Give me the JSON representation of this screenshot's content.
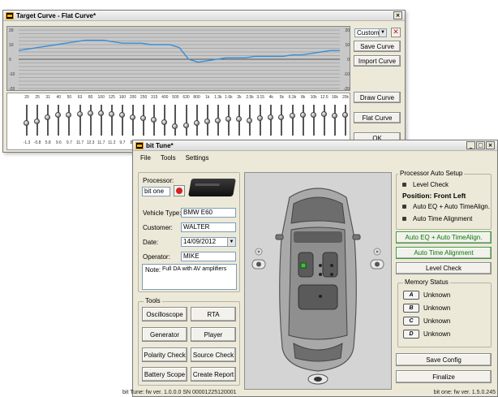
{
  "target_window": {
    "title": "Target Curve - Flat Curve*",
    "close": "×",
    "preset_select": "Custom",
    "save_curve": "Save Curve",
    "import_curve": "Import Curve",
    "draw_curve": "Draw Curve",
    "flat_curve": "Flat Curve",
    "ok": "OK",
    "graph": {
      "left_ticks": [
        "20",
        "10",
        "0",
        "-10",
        "-20"
      ],
      "right_ticks": [
        "20",
        "10",
        "0",
        "-10",
        "-20"
      ],
      "curve_values": [
        6,
        7,
        8,
        9,
        10,
        11,
        12,
        13,
        13,
        13,
        12,
        11,
        11,
        11,
        10,
        10,
        10,
        8,
        0,
        -2,
        -1,
        0,
        1,
        1,
        1,
        2,
        2,
        2,
        2,
        3,
        3,
        4,
        5,
        6,
        6
      ]
    },
    "freq_labels": [
      "20",
      "25",
      "31",
      "40",
      "50",
      "63",
      "80",
      "100",
      "125",
      "160",
      "200",
      "250",
      "315",
      "400",
      "500",
      "630",
      "800",
      "1k",
      "1.3k",
      "1.6k",
      "2k",
      "2.5k",
      "3.15",
      "4k",
      "5k",
      "6.3k",
      "8k",
      "10k",
      "12.5",
      "16k",
      "20k"
    ],
    "gain_labels": [
      "-1.3",
      "-0.8",
      "5.8",
      "9.6",
      "9.7",
      "11.7",
      "12.3",
      "11.7",
      "11.2",
      "9.7",
      "8.0"
    ],
    "slider_levels": [
      0.62,
      0.55,
      0.4,
      0.3,
      0.3,
      0.25,
      0.22,
      0.22,
      0.25,
      0.3,
      0.38,
      0.42,
      0.48,
      0.58,
      0.75,
      0.72,
      0.6,
      0.55,
      0.5,
      0.45,
      0.45,
      0.5,
      0.42,
      0.4,
      0.38,
      0.32,
      0.28,
      0.3,
      0.25,
      0.32,
      0.3
    ]
  },
  "main_window": {
    "title": "bit Tune*",
    "controls": [
      "_",
      "□",
      "×"
    ],
    "menu": [
      "File",
      "Tools",
      "Settings"
    ],
    "processor_label": "Processor:",
    "processor_value": "bit one",
    "vehicle_label": "Vehicle Type:",
    "vehicle_value": "BMW E60",
    "customer_label": "Customer:",
    "customer_value": "WALTER",
    "date_label": "Date:",
    "date_value": "14/09/2012",
    "operator_label": "Operator:",
    "operator_value": "MIKE",
    "note_label": "Note:",
    "note_value": "Full DA with AV amplifiers",
    "tools_title": "Tools",
    "tools": [
      "Oscilloscope",
      "RTA",
      "Generator",
      "Player",
      "Polarity Check",
      "Source Check",
      "Battery Scope",
      "Create Report"
    ],
    "auto_setup_title": "Processor Auto Setup",
    "level_check_item": "Level Check",
    "position_label": "Position: Front Left",
    "auto_eq_item": "Auto EQ + Auto TimeAlign.",
    "auto_time_item": "Auto Time Alignment",
    "btn_auto_eq": "Auto EQ + Auto TimeAlign.",
    "btn_auto_time": "Auto Time Alignment",
    "btn_level_check": "Level Check",
    "memory_title": "Memory Status",
    "memory": [
      {
        "key": "A",
        "status": "Unknown"
      },
      {
        "key": "B",
        "status": "Unknown"
      },
      {
        "key": "C",
        "status": "Unknown"
      },
      {
        "key": "D",
        "status": "Unknown"
      }
    ],
    "save_config": "Save Config",
    "finalize": "Finalize",
    "status_left": "bit Tune: fw ver. 1.0.0.0  SN 00001225120001",
    "status_right": "bit one: fw ver. 1.5.0.245"
  },
  "colors": {
    "window_bg": "#ece9d8",
    "graph_bg": "#c8c8c8",
    "curve": "#3a8fd6",
    "green_text": "#0a7a0a"
  }
}
